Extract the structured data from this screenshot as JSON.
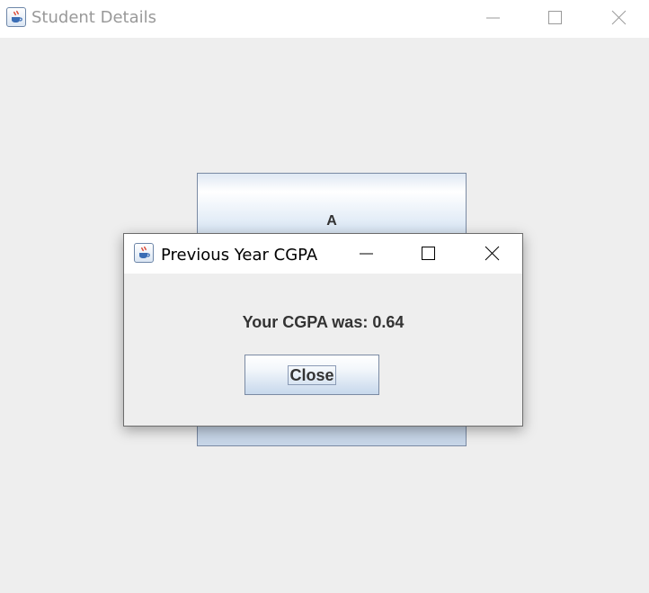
{
  "main_window": {
    "title": "Student Details",
    "icon": "java-cup-icon",
    "controls": [
      "minimize-icon",
      "maximize-icon",
      "close-icon"
    ]
  },
  "background_button": {
    "label": "A"
  },
  "dialog": {
    "title": "Previous Year CGPA",
    "icon": "java-cup-icon",
    "controls": [
      "minimize-icon",
      "maximize-icon",
      "close-icon"
    ],
    "message": "Your CGPA was: 0.64",
    "close_button_label": "Close"
  },
  "colors": {
    "window_background": "#eeeeee",
    "titlebar_background": "#ffffff",
    "button_gradient_top": "#ffffff",
    "button_gradient_bottom": "#c7d8ec",
    "text": "#333333"
  }
}
